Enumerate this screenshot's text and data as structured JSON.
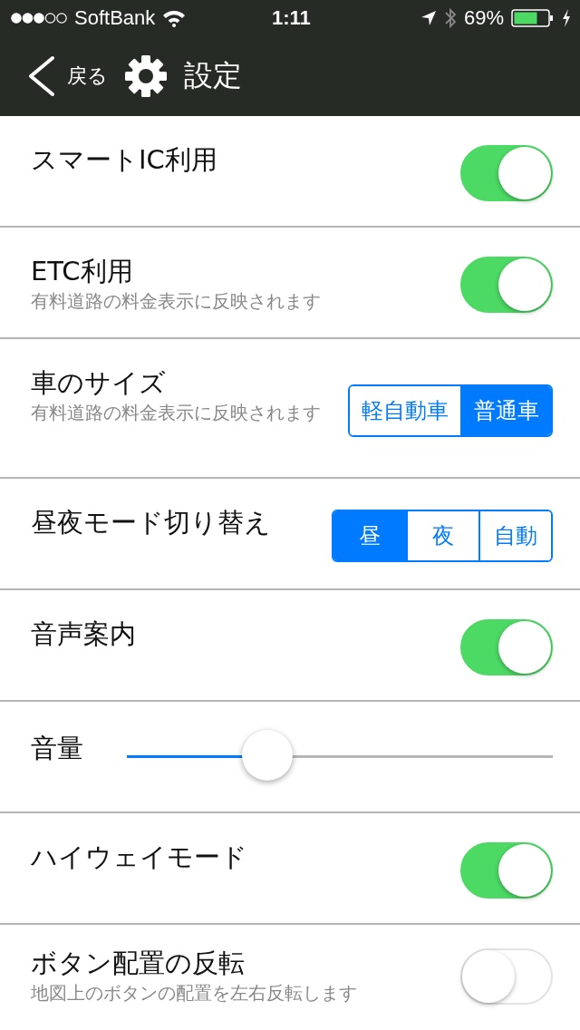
{
  "status_bar": {
    "carrier": "SoftBank",
    "time": "1:11",
    "battery": "69%"
  },
  "nav": {
    "back": "戻る",
    "title": "設定"
  },
  "rows": [
    {
      "kind": "toggle",
      "title": "スマートIC利用",
      "on": true
    },
    {
      "kind": "toggle",
      "title": "ETC利用",
      "subtitle": "有料道路の料金表示に反映されます",
      "on": true
    },
    {
      "kind": "segment",
      "title": "車のサイズ",
      "subtitle": "有料道路の料金表示に反映されます",
      "options": [
        {
          "label": "軽自動車",
          "selected": false
        },
        {
          "label": "普通車",
          "selected": true
        }
      ]
    },
    {
      "kind": "segment",
      "title": "昼夜モード切り替え",
      "options": [
        {
          "label": "昼",
          "selected": true
        },
        {
          "label": "夜",
          "selected": false
        },
        {
          "label": "自動",
          "selected": false
        }
      ]
    },
    {
      "kind": "toggle",
      "title": "音声案内",
      "on": true
    },
    {
      "kind": "slider",
      "title": "音量",
      "level": 0.33
    },
    {
      "kind": "toggle",
      "title": "ハイウェイモード",
      "on": true
    },
    {
      "kind": "toggle",
      "title": "ボタン配置の反転",
      "subtitle": "地図上のボタンの配置を左右反転します",
      "on": false
    }
  ]
}
